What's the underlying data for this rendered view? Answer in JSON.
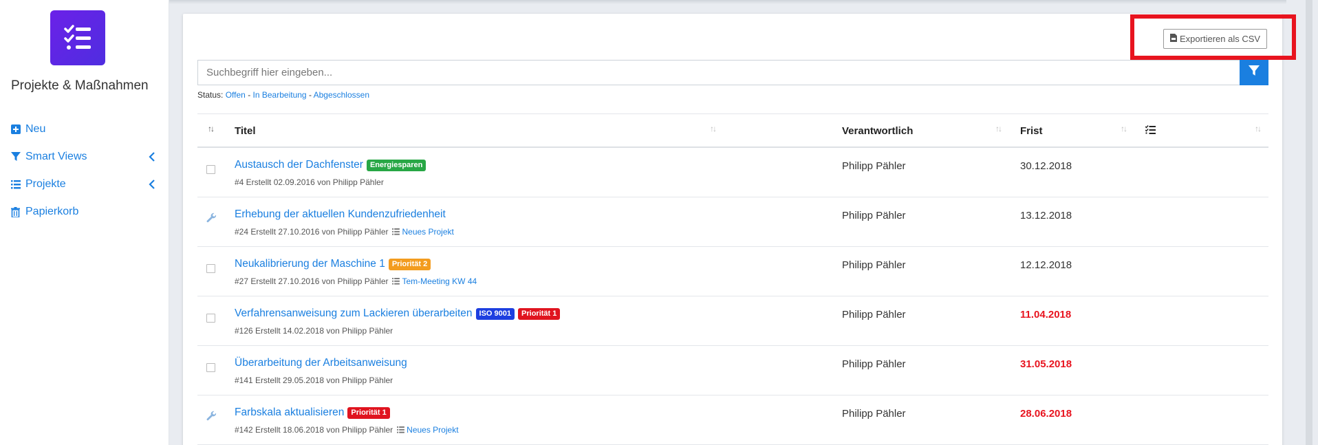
{
  "app": {
    "title": "Projekte & Maßnahmen",
    "accent": "#1a7fe0",
    "logo_gradient": [
      "#6b21e8",
      "#4f2de0"
    ]
  },
  "sidebar": {
    "items": [
      {
        "label": "Neu",
        "icon": "plus-square-icon"
      },
      {
        "label": "Smart Views",
        "icon": "filter-icon",
        "has_chevron": true
      },
      {
        "label": "Projekte",
        "icon": "list-icon",
        "has_chevron": true
      },
      {
        "label": "Papierkorb",
        "icon": "trash-icon"
      }
    ]
  },
  "toolbar": {
    "export_label": "Exportieren als CSV",
    "export_icon": "csv-file-icon"
  },
  "search": {
    "placeholder": "Suchbegriff hier eingeben...",
    "value": ""
  },
  "status_filter": {
    "label": "Status:",
    "options": [
      "Offen",
      "In Bearbeitung",
      "Abgeschlossen"
    ],
    "separator": "-"
  },
  "table": {
    "columns": [
      "Titel",
      "Verantwortlich",
      "Frist"
    ],
    "rows": [
      {
        "state": "open",
        "title": "Austausch der Dachfenster",
        "badges": [
          {
            "text": "Energiesparen",
            "color": "#28a745"
          }
        ],
        "meta": "#4 Erstellt 02.09.2016 von Philipp Pähler",
        "project": "",
        "responsible": "Philipp Pähler",
        "due": "30.12.2018",
        "overdue": false
      },
      {
        "state": "in-progress",
        "title": "Erhebung der aktuellen Kundenzufriedenheit",
        "badges": [],
        "meta": "#24 Erstellt 27.10.2016 von Philipp Pähler",
        "project": "Neues Projekt",
        "responsible": "Philipp Pähler",
        "due": "13.12.2018",
        "overdue": false
      },
      {
        "state": "open",
        "title": "Neukalibrierung der Maschine 1",
        "badges": [
          {
            "text": "Priorität 2",
            "color": "#f39c1f"
          }
        ],
        "meta": "#27 Erstellt 27.10.2016 von Philipp Pähler",
        "project": "Tem-Meeting KW 44",
        "responsible": "Philipp Pähler",
        "due": "12.12.2018",
        "overdue": false
      },
      {
        "state": "open",
        "title": "Verfahrensanweisung zum Lackieren überarbeiten",
        "badges": [
          {
            "text": "ISO 9001",
            "color": "#1d3fe0"
          },
          {
            "text": "Priorität 1",
            "color": "#e0141f"
          }
        ],
        "meta": "#126 Erstellt 14.02.2018 von Philipp Pähler",
        "project": "",
        "responsible": "Philipp Pähler",
        "due": "11.04.2018",
        "overdue": true
      },
      {
        "state": "open",
        "title": "Überarbeitung der Arbeitsanweisung",
        "badges": [],
        "meta": "#141 Erstellt 29.05.2018 von Philipp Pähler",
        "project": "",
        "responsible": "Philipp Pähler",
        "due": "31.05.2018",
        "overdue": true
      },
      {
        "state": "in-progress",
        "title": "Farbskala aktualisieren",
        "badges": [
          {
            "text": "Priorität 1",
            "color": "#e0141f"
          }
        ],
        "meta": "#142 Erstellt 18.06.2018 von Philipp Pähler",
        "project": "Neues Projekt",
        "responsible": "Philipp Pähler",
        "due": "28.06.2018",
        "overdue": true
      }
    ]
  },
  "colors": {
    "overdue": "#e8141f",
    "highlight_box": "#e8141f"
  }
}
